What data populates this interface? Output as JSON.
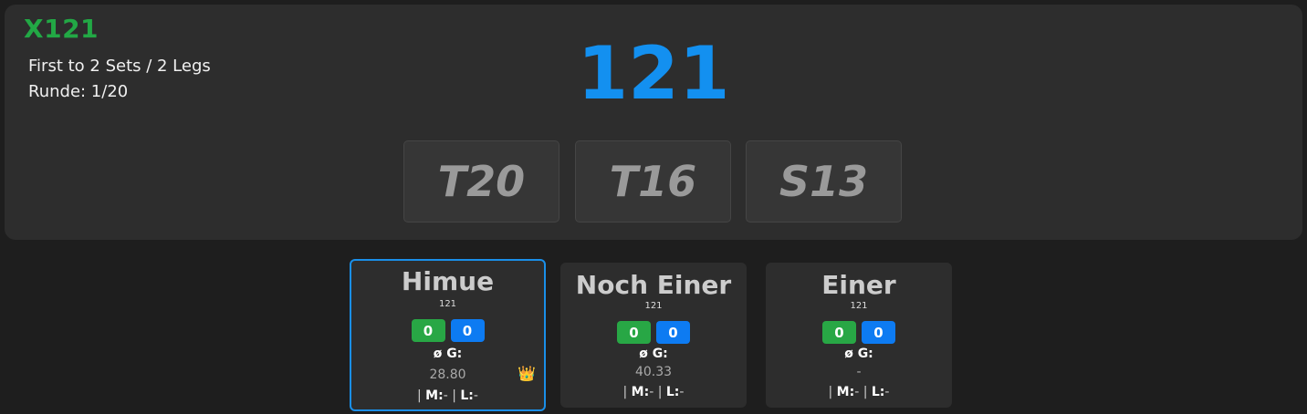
{
  "header": {
    "game_title": "X121",
    "format": "First to 2 Sets / 2 Legs",
    "round": "Runde: 1/20",
    "current_score": "121"
  },
  "checkout": [
    "T20",
    "T16",
    "S13"
  ],
  "players": [
    {
      "name": "Himue",
      "score": "121",
      "sets": "0",
      "legs": "0",
      "avg_label": "ø G:",
      "avg": "28.80",
      "stats_sep": "|",
      "m_label": "M:",
      "m_value": "-",
      "l_label": "L:",
      "l_value": "-",
      "active": true,
      "crown": "👑"
    },
    {
      "name": "Noch Einer",
      "score": "121",
      "sets": "0",
      "legs": "0",
      "avg_label": "ø G:",
      "avg": "40.33",
      "stats_sep": "|",
      "m_label": "M:",
      "m_value": "-",
      "l_label": "L:",
      "l_value": "-",
      "active": false
    },
    {
      "name": "Einer",
      "score": "121",
      "sets": "0",
      "legs": "0",
      "avg_label": "ø G:",
      "avg": "-",
      "stats_sep": "|",
      "m_label": "M:",
      "m_value": "-",
      "l_label": "L:",
      "l_value": "-",
      "active": false
    }
  ],
  "colors": {
    "title_green": "#22a845",
    "score_blue": "#1390f0",
    "sets_green": "#28a745",
    "legs_blue": "#0d7bf2",
    "active_border": "#1a8fe8"
  }
}
